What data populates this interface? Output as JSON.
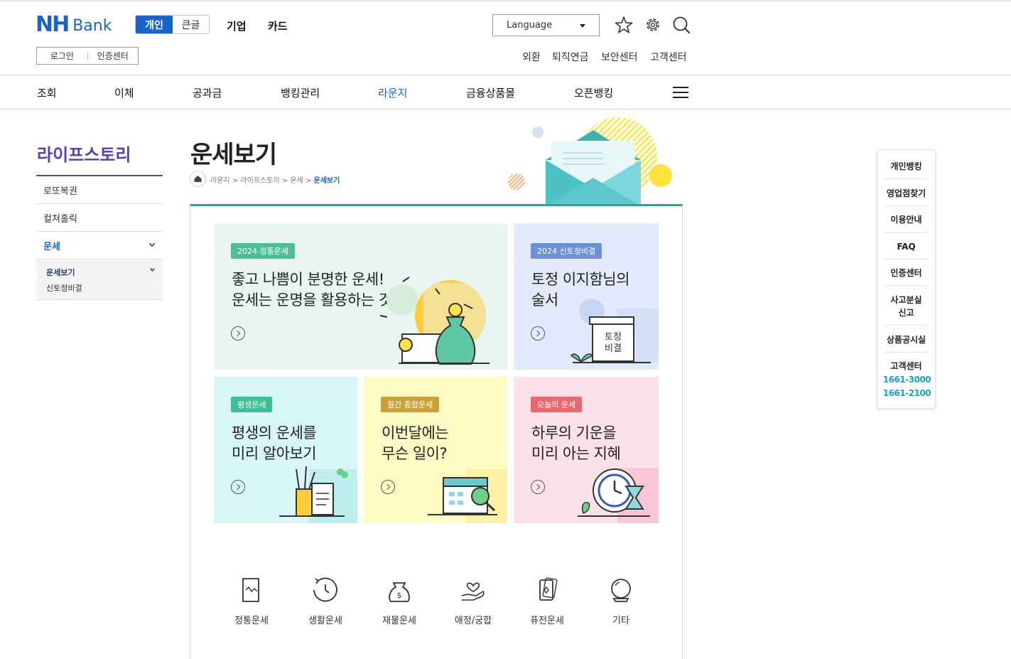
{
  "header": {
    "logo_nh": "NH",
    "logo_bank": "Bank",
    "segment_on": "개인",
    "segment_off": "큰글",
    "menu_corp": "기업",
    "menu_card": "카드",
    "login": "로그인",
    "cert": "인증센터",
    "language": "Language",
    "utility": [
      "외환",
      "퇴직연금",
      "보안센터",
      "고객센터"
    ]
  },
  "nav": {
    "items": [
      "조회",
      "이체",
      "공과금",
      "뱅킹관리",
      "라운지",
      "금융상품몰",
      "오픈뱅킹"
    ],
    "active": "라운지"
  },
  "sidebar": {
    "title": "라이프스토리",
    "items": [
      "로또복권",
      "컬쳐홀릭",
      "운세"
    ],
    "sub_active": "운세보기",
    "sub_other": "신토정비결"
  },
  "page": {
    "title": "운세보기",
    "breadcrumb": [
      "라운지",
      "라이프스토리",
      "운세"
    ],
    "breadcrumb_current": "운세보기",
    "bc_sep": ">"
  },
  "cards": [
    {
      "badge": "2024 정통운세",
      "line1": "좋고 나쁨이 분명한 운세!",
      "line2": "운세는 운명을 활용하는 것",
      "bg": "#e8f5f0",
      "badge_color": "#4cbf9a"
    },
    {
      "badge": "2024 신토정비결",
      "line1": "토정 이지함님의",
      "line2": "술서",
      "bg": "#e2eafb",
      "badge_color": "#6d8fd6",
      "book_label1": "토정",
      "book_label2": "비결"
    },
    {
      "badge": "평생운세",
      "line1": "평생의 운세를",
      "line2": "미리 알아보기",
      "bg": "#d9f6f7",
      "badge_color": "#3fbf95"
    },
    {
      "badge": "월간 종합운세",
      "line1": "이번달에는",
      "line2": "무슨 일이?",
      "bg": "#fdfbc4",
      "badge_color": "#c9a13a"
    },
    {
      "badge": "오늘의 운세",
      "line1": "하루의 기운을",
      "line2": "미리 아는 지혜",
      "bg": "#fbe1ea",
      "badge_color": "#ef6670"
    }
  ],
  "categories": [
    "정통운세",
    "생활운세",
    "재물운세",
    "애정/궁합",
    "퓨전운세",
    "기타"
  ],
  "quick_menu": {
    "items": [
      "개인뱅킹",
      "영업점찾기",
      "이용안내",
      "FAQ",
      "인증센터",
      "사고분실",
      "신고",
      "상품공시실",
      "고객센터"
    ],
    "phones": [
      "1661-3000",
      "1661-2100"
    ]
  }
}
